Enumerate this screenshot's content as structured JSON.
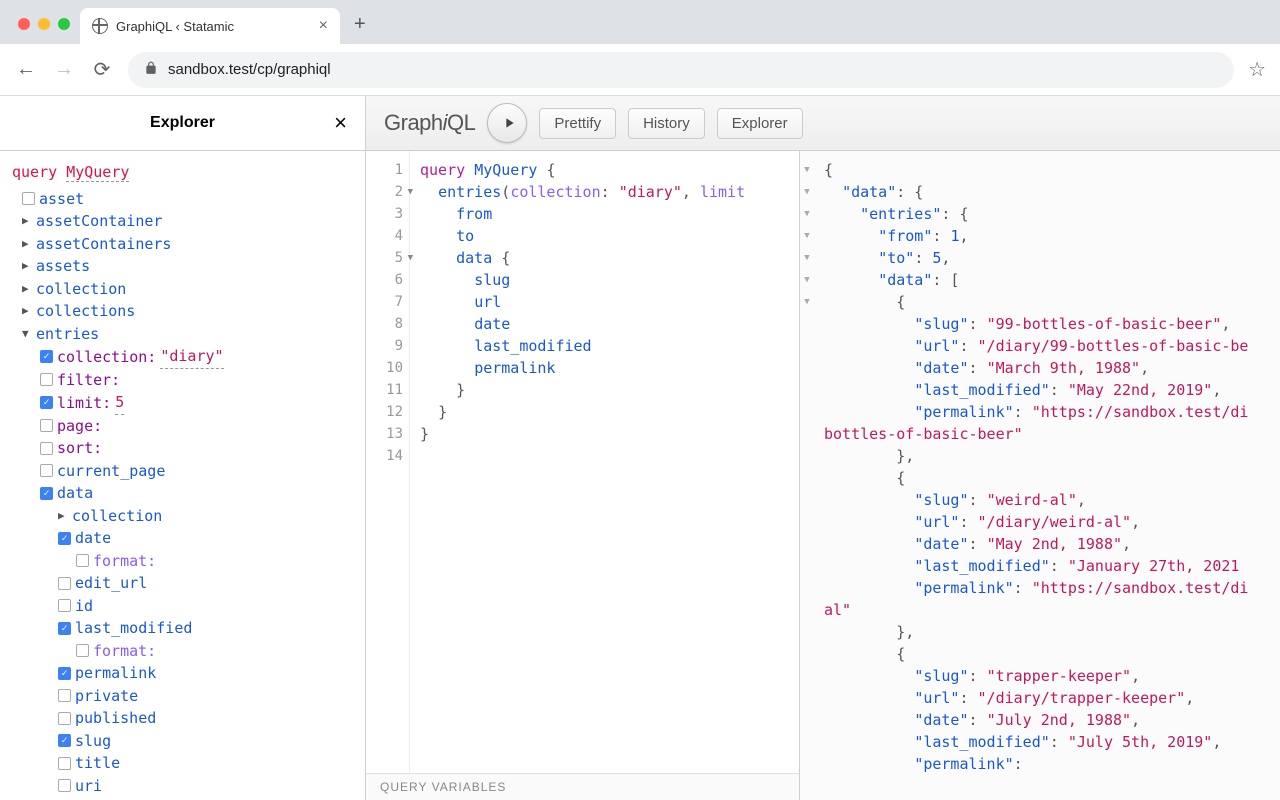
{
  "browser": {
    "tab_title": "GraphiQL ‹ Statamic",
    "url": "sandbox.test/cp/graphiql"
  },
  "explorer": {
    "title": "Explorer",
    "query_keyword": "query",
    "query_name": "MyQuery",
    "tree": {
      "asset": "asset",
      "assetContainer": "assetContainer",
      "assetContainers": "assetContainers",
      "assets": "assets",
      "collection": "collection",
      "collections": "collections",
      "entries": "entries",
      "entries_args": {
        "collection_label": "collection:",
        "collection_value": "\"diary\"",
        "filter_label": "filter:",
        "limit_label": "limit:",
        "limit_value": "5",
        "page_label": "page:",
        "sort_label": "sort:"
      },
      "current_page": "current_page",
      "data": "data",
      "data_children": {
        "collection": "collection",
        "date": "date",
        "format": "format:",
        "edit_url": "edit_url",
        "id": "id",
        "last_modified": "last_modified",
        "permalink": "permalink",
        "private": "private",
        "published": "published",
        "slug": "slug",
        "title": "title",
        "uri": "uri"
      }
    }
  },
  "topbar": {
    "logo_a": "Graph",
    "logo_i": "i",
    "logo_b": "QL",
    "prettify": "Prettify",
    "history": "History",
    "explorer": "Explorer"
  },
  "editor": {
    "lines": [
      "1",
      "2",
      "3",
      "4",
      "5",
      "6",
      "7",
      "8",
      "9",
      "10",
      "11",
      "12",
      "13",
      "14"
    ],
    "query_vars": "QUERY VARIABLES",
    "code": {
      "l1_kw": "query",
      "l1_name": "MyQuery",
      "l2_fn": "entries",
      "l2_arg1": "collection",
      "l2_val1": "\"diary\"",
      "l2_arg2": "limit",
      "l3": "from",
      "l4": "to",
      "l5": "data",
      "l6": "slug",
      "l7": "url",
      "l8": "date",
      "l9": "last_modified",
      "l10": "permalink"
    }
  },
  "result": {
    "data_key": "\"data\"",
    "entries_key": "\"entries\"",
    "from_key": "\"from\"",
    "from_val": "1",
    "to_key": "\"to\"",
    "to_val": "5",
    "array_key": "\"data\"",
    "items": [
      {
        "slug": "\"99-bottles-of-basic-beer\"",
        "url": "\"/diary/99-bottles-of-basic-be",
        "date": "\"March 9th, 1988\"",
        "last_modified": "\"May 22nd, 2019\"",
        "permalink": "\"https://sandbox.test/di",
        "permalink_wrap": "bottles-of-basic-beer\""
      },
      {
        "slug": "\"weird-al\"",
        "url": "\"/diary/weird-al\"",
        "date": "\"May 2nd, 1988\"",
        "last_modified": "\"January 27th, 2021",
        "permalink": "\"https://sandbox.test/di",
        "permalink_wrap": "al\""
      },
      {
        "slug": "\"trapper-keeper\"",
        "url": "\"/diary/trapper-keeper\"",
        "date": "\"July 2nd, 1988\"",
        "last_modified": "\"July 5th, 2019\"",
        "permalink": "\"permalink\""
      }
    ],
    "keys": {
      "slug": "\"slug\"",
      "url": "\"url\"",
      "date": "\"date\"",
      "last_modified": "\"last_modified\"",
      "permalink": "\"permalink\""
    }
  }
}
